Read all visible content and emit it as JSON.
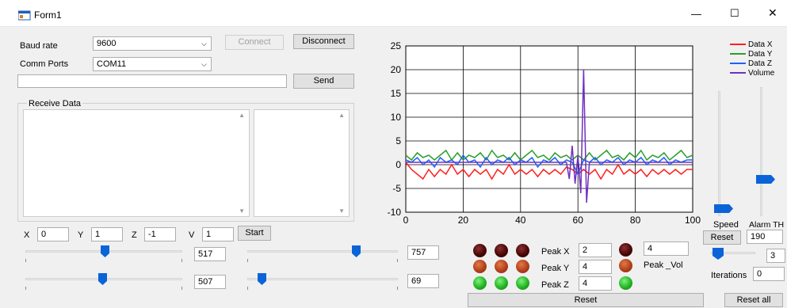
{
  "window": {
    "title": "Form1",
    "minimize_glyph": "—",
    "maximize_glyph": "☐",
    "close_glyph": "✕"
  },
  "serial": {
    "baud_label": "Baud rate",
    "baud_value": "9600",
    "port_label": "Comm Ports",
    "port_value": "COM11",
    "connect_label": "Connect",
    "disconnect_label": "Disconnect",
    "send_value": "",
    "send_label": "Send"
  },
  "receive": {
    "label": "Receive Data"
  },
  "xyzv": {
    "x_label": "X",
    "x_value": "0",
    "y_label": "Y",
    "y_value": "1",
    "z_label": "Z",
    "z_value": "-1",
    "v_label": "V",
    "v_value": "1",
    "start_label": "Start"
  },
  "sliders": {
    "s1_value": "517",
    "s2_value": "507",
    "s3_value": "757",
    "s4_value": "69",
    "s1_level": 0.51,
    "s2_level": 0.49,
    "s3_level": 0.74,
    "s4_level": 0.07
  },
  "peaks": {
    "x_label": "Peak X",
    "x_value": "2",
    "y_label": "Peak Y",
    "y_value": "4",
    "z_label": "Peak Z",
    "z_value": "4",
    "vol_label": "Peak _Vol",
    "vol_value": "4",
    "reset_label": "Reset"
  },
  "right_panel": {
    "speed_label": "Speed",
    "alarm_label": "Alarm TH",
    "reset_label": "Reset",
    "alarm_value": "190",
    "small_value": "3",
    "iterations_label": "Iterations",
    "iterations_value": "0",
    "reset_all_label": "Reset all",
    "speed_level": 0.02,
    "alarm_level": 0.26
  },
  "chart_data": {
    "type": "line",
    "xlim": [
      0,
      100
    ],
    "ylim": [
      -10,
      25
    ],
    "x_ticks": [
      "0",
      "20",
      "40",
      "60",
      "80",
      "100"
    ],
    "y_ticks": [
      "25",
      "20",
      "15",
      "10",
      "5",
      "0",
      "-5",
      "-10"
    ],
    "grid": true,
    "legend_position": "top-right",
    "series": [
      {
        "name": "Data X",
        "color": "#ff2020",
        "x": [
          0,
          2,
          4,
          6,
          8,
          10,
          12,
          14,
          16,
          18,
          20,
          22,
          24,
          26,
          28,
          30,
          32,
          34,
          36,
          38,
          40,
          42,
          44,
          46,
          48,
          50,
          52,
          54,
          56,
          58,
          60,
          62,
          64,
          66,
          68,
          70,
          72,
          74,
          76,
          78,
          80,
          82,
          84,
          86,
          88,
          90,
          92,
          94,
          96,
          98,
          100
        ],
        "values": [
          0.5,
          -1,
          -2,
          -3,
          -1,
          -2.5,
          -1,
          -2,
          0,
          -2,
          -1,
          -2.5,
          -1,
          -2,
          -1,
          -3,
          -1,
          -2,
          0,
          -2,
          -1,
          -2,
          -1,
          -2.5,
          -1,
          -2,
          -1,
          -2,
          -0.5,
          -1,
          -2,
          -1,
          -2,
          -1,
          -3,
          -1,
          -2,
          0,
          -2,
          -1,
          -2,
          -1,
          -2.5,
          -1,
          -2,
          -1,
          -2,
          -1,
          -2,
          -1,
          -1
        ]
      },
      {
        "name": "Data Y",
        "color": "#2aa02a",
        "x": [
          0,
          2,
          4,
          6,
          8,
          10,
          12,
          14,
          16,
          18,
          20,
          22,
          24,
          26,
          28,
          30,
          32,
          34,
          36,
          38,
          40,
          42,
          44,
          46,
          48,
          50,
          52,
          54,
          56,
          58,
          60,
          62,
          64,
          66,
          68,
          70,
          72,
          74,
          76,
          78,
          80,
          82,
          84,
          86,
          88,
          90,
          92,
          94,
          96,
          98,
          100
        ],
        "values": [
          2,
          1,
          2.5,
          1.5,
          2,
          1,
          2,
          3,
          1,
          2.5,
          1,
          2,
          1.5,
          2.5,
          1,
          3,
          1.5,
          2,
          1,
          2.5,
          1,
          2,
          3,
          1.5,
          2,
          1,
          2.5,
          1.5,
          2,
          1,
          2,
          1,
          2.5,
          1,
          2,
          3,
          1.5,
          2,
          1,
          2.5,
          1.5,
          3,
          1,
          2,
          1.5,
          2.5,
          1,
          2,
          3,
          1.5,
          2
        ]
      },
      {
        "name": "Data Z",
        "color": "#2060ff",
        "x": [
          0,
          2,
          4,
          6,
          8,
          10,
          12,
          14,
          16,
          18,
          20,
          22,
          24,
          26,
          28,
          30,
          32,
          34,
          36,
          38,
          40,
          42,
          44,
          46,
          48,
          50,
          52,
          54,
          56,
          58,
          60,
          62,
          64,
          66,
          68,
          70,
          72,
          74,
          76,
          78,
          80,
          82,
          84,
          86,
          88,
          90,
          92,
          94,
          96,
          98,
          100
        ],
        "values": [
          1,
          0.5,
          1.5,
          0,
          1,
          -0.5,
          1.5,
          0.5,
          1,
          0,
          2,
          0.5,
          1,
          -0.5,
          1.5,
          0,
          1,
          0.5,
          1.5,
          0,
          1,
          0.5,
          1.5,
          -0.5,
          1,
          0.5,
          1.5,
          0,
          1,
          0.5,
          -2,
          1,
          0.5,
          1.5,
          0,
          1,
          0.5,
          1.5,
          0,
          1,
          0.5,
          1.5,
          0,
          1,
          0.5,
          1.5,
          0,
          1,
          0.5,
          1,
          1
        ]
      },
      {
        "name": "Volume",
        "color": "#7030c0",
        "x": [
          0,
          10,
          20,
          30,
          40,
          50,
          56,
          57,
          58,
          59,
          60,
          61,
          62,
          63,
          64,
          66,
          70,
          80,
          90,
          100
        ],
        "values": [
          0.5,
          0.5,
          0.5,
          0.5,
          0.5,
          0.5,
          0.5,
          -3,
          4,
          -4,
          2,
          -6,
          20,
          -8,
          0.5,
          0.5,
          0.5,
          0.5,
          0.5,
          0.5
        ]
      }
    ]
  }
}
